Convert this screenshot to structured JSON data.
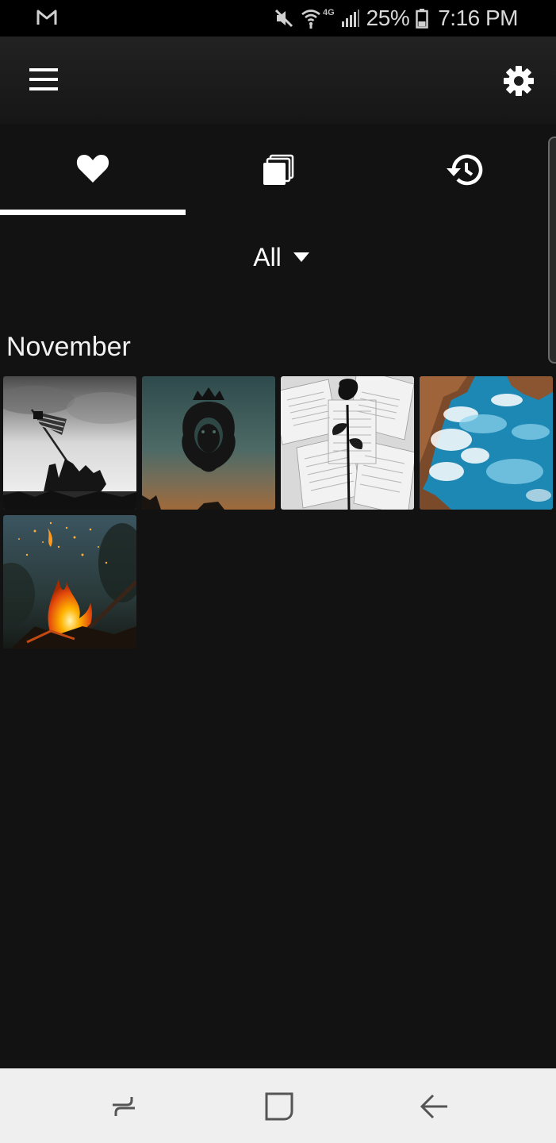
{
  "status_bar": {
    "notification_icon": "gmail-icon",
    "network_label": "4G",
    "battery_percent": "25%",
    "time": "7:16 PM",
    "icons": [
      "mute-icon",
      "wifi-icon",
      "signal-icon",
      "battery-icon"
    ]
  },
  "app_bar": {
    "menu_icon": "hamburger-menu-icon",
    "settings_icon": "gear-icon"
  },
  "tabs": [
    {
      "icon": "heart-icon",
      "selected": true
    },
    {
      "icon": "stacked-cards-icon",
      "selected": false
    },
    {
      "icon": "history-icon",
      "selected": false
    }
  ],
  "filter": {
    "label": "All",
    "icon": "caret-down-icon"
  },
  "section": {
    "title": "November"
  },
  "thumbnails": [
    {
      "subject": "flag-raising-photo"
    },
    {
      "subject": "lion-crown-logo"
    },
    {
      "subject": "rose-on-book-pages"
    },
    {
      "subject": "ocean-waves-on-rocks"
    },
    {
      "subject": "campfire"
    }
  ],
  "nav_bar": {
    "buttons": [
      "recent-apps-icon",
      "home-icon",
      "back-icon"
    ]
  },
  "colors": {
    "background": "#121212",
    "app_bar": "#1c1c1c",
    "accent": "#ffffff",
    "nav_bar": "#efefef"
  }
}
